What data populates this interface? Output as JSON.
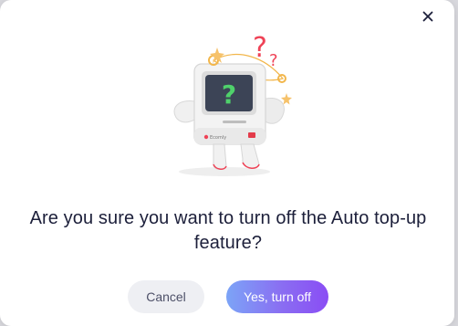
{
  "dialog": {
    "question": "Are you sure you want to turn off the Auto top-up feature?",
    "cancel_label": "Cancel",
    "confirm_label": "Yes, turn off",
    "close_icon": "close-icon",
    "illustration": {
      "brand_label": "Ecomly",
      "screen_symbol": "?",
      "question_marks": [
        "?",
        "?"
      ]
    }
  },
  "colors": {
    "question_text": "#1c1f3a",
    "cancel_bg": "#eeeff3",
    "cancel_text": "#4d5068",
    "confirm_gradient_start": "#7ca4f7",
    "confirm_gradient_end": "#8a4df4",
    "question_mark_red": "#ef4256",
    "screen_question_green": "#4fd16b"
  }
}
